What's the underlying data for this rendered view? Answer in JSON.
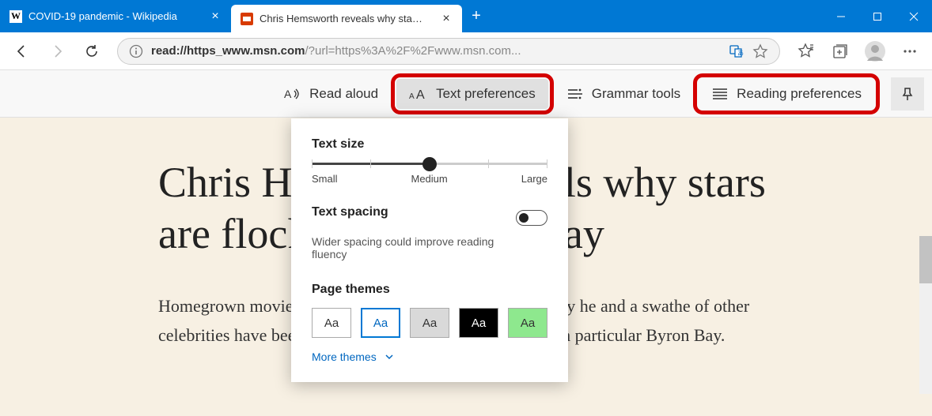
{
  "tabs": [
    {
      "title": "COVID-19 pandemic - Wikipedia",
      "favicon": "W",
      "active": false
    },
    {
      "title": "Chris Hemsworth reveals why sta…",
      "favicon": "msn",
      "active": true
    }
  ],
  "address": {
    "info_icon": "ⓘ",
    "proto": "read://",
    "domain": "https_www.msn.com",
    "rest": "/?url=https%3A%2F%2Fwww.msn.com...",
    "translate_icon": "translate",
    "star_icon": "star"
  },
  "nav_icons": {
    "favorites": "favorites",
    "collections": "collections",
    "profile": "profile",
    "more": "more"
  },
  "toolbar": {
    "read_aloud": "Read aloud",
    "text_prefs": "Text preferences",
    "grammar": "Grammar tools",
    "reading_prefs": "Reading preferences"
  },
  "popover": {
    "text_size_label": "Text size",
    "slider": {
      "small": "Small",
      "medium": "Medium",
      "large": "Large",
      "value": 50
    },
    "text_spacing_label": "Text spacing",
    "text_spacing_hint": "Wider spacing could improve reading fluency",
    "text_spacing_on": false,
    "page_themes_label": "Page themes",
    "themes": [
      {
        "label": "Aa",
        "bg": "#ffffff",
        "fg": "#333333",
        "selected": false
      },
      {
        "label": "Aa",
        "bg": "#ffffff",
        "fg": "#0067c0",
        "selected": true
      },
      {
        "label": "Aa",
        "bg": "#d9d9d9",
        "fg": "#333333",
        "selected": false
      },
      {
        "label": "Aa",
        "bg": "#000000",
        "fg": "#ffffff",
        "selected": false
      },
      {
        "label": "Aa",
        "bg": "#8ee88e",
        "fg": "#333333",
        "selected": false
      }
    ],
    "more_themes": "More themes"
  },
  "article": {
    "headline": "Chris Hemsworth reveals why stars are flocking to Byron Bay",
    "body": "Homegrown movie star Chris Hemsworth has revealed why he and a swathe of other celebrities have been leaving Los Angeles for Australia - in particular Byron Bay."
  }
}
